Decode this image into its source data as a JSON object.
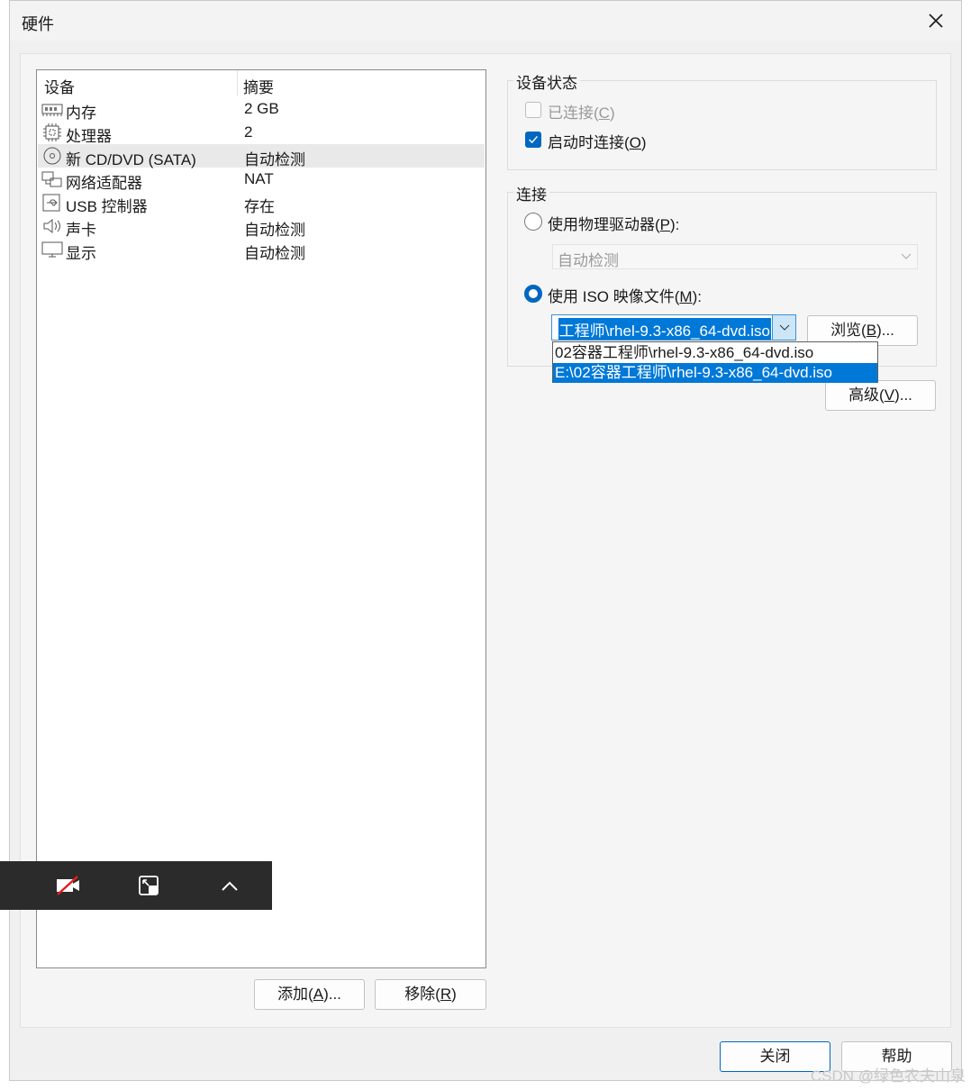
{
  "window": {
    "title": "硬件"
  },
  "device_list": {
    "col_device": "设备",
    "col_summary": "摘要",
    "rows": [
      {
        "name": "内存",
        "summary": "2 GB",
        "icon": "memory-icon"
      },
      {
        "name": "处理器",
        "summary": "2",
        "icon": "cpu-icon"
      },
      {
        "name": "新 CD/DVD (SATA)",
        "summary": "自动检测",
        "icon": "cd-dvd-icon",
        "selected": true
      },
      {
        "name": "网络适配器",
        "summary": "NAT",
        "icon": "network-icon"
      },
      {
        "name": "USB 控制器",
        "summary": "存在",
        "icon": "usb-icon"
      },
      {
        "name": "声卡",
        "summary": "自动检测",
        "icon": "speaker-icon"
      },
      {
        "name": "显示",
        "summary": "自动检测",
        "icon": "monitor-icon"
      }
    ],
    "add_button": {
      "text": "添加(",
      "key": "A",
      "suffix": ")..."
    },
    "remove_button": {
      "text": "移除(",
      "key": "R",
      "suffix": ")"
    }
  },
  "device_status": {
    "title": "设备状态",
    "connected": {
      "text": "已连接(",
      "key": "C",
      "suffix": ")",
      "checked": false,
      "disabled": true
    },
    "connect_at_power_on": {
      "text": "启动时连接(",
      "key": "O",
      "suffix": ")",
      "checked": true
    }
  },
  "connection": {
    "title": "连接",
    "physical_drive": {
      "text": "使用物理驱动器(",
      "key": "P",
      "suffix": "):",
      "selected": false
    },
    "physical_drive_value": "自动检测",
    "iso_image": {
      "text": "使用 ISO 映像文件(",
      "key": "M",
      "suffix": "):",
      "selected": true
    },
    "iso_path_visible": "工程师\\rhel-9.3-x86_64-dvd.iso",
    "iso_options": [
      "02容器工程师\\rhel-9.3-x86_64-dvd.iso",
      "E:\\02容器工程师\\rhel-9.3-x86_64-dvd.iso"
    ],
    "highlighted_option_index": 1,
    "browse_button": {
      "text": "浏览(",
      "key": "B",
      "suffix": ")..."
    },
    "advanced_button": {
      "text": "高级(",
      "key": "V",
      "suffix": ")..."
    }
  },
  "footer": {
    "close_label": "关闭",
    "help_label": "帮助"
  },
  "watermark": "CSDN @绿色农夫山泉",
  "colors": {
    "accent": "#0067c0",
    "highlight": "#0078d7",
    "overlay_bg": "#2b2b2b"
  }
}
